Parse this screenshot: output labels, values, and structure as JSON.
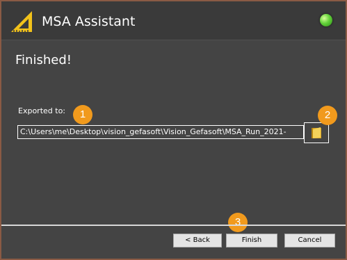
{
  "titlebar": {
    "title": "MSA Assistant",
    "app_icon": "ruler-triangle-icon",
    "status_icon": "green-status-light-icon",
    "status_color": "#4cc72a"
  },
  "page": {
    "heading": "Finished!"
  },
  "export": {
    "label": "Exported to:",
    "path": "C:\\Users\\me\\Desktop\\vision_gefasoft\\Vision_Gefasoft\\MSA_Run_2021-",
    "browse_icon": "folder-icon"
  },
  "callouts": [
    "1",
    "2",
    "3"
  ],
  "callout_color": "#f19a1d",
  "footer": {
    "back_label": "< Back",
    "finish_label": "Finish",
    "cancel_label": "Cancel"
  }
}
